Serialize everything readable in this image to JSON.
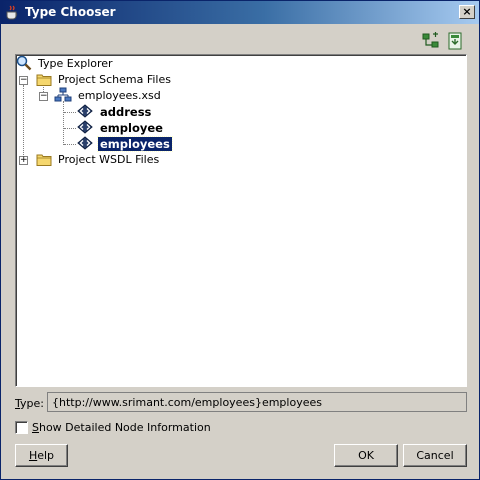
{
  "window": {
    "title": "Type Chooser",
    "close_glyph": "×"
  },
  "toolbar": {
    "icons": [
      "schema-hierarchy-icon",
      "import-schema-icon"
    ]
  },
  "tree": {
    "root": {
      "label": "Type Explorer",
      "icon": "magnifier-icon"
    },
    "nodes": [
      {
        "label": "Project Schema Files",
        "icon": "folder-icon",
        "expanded": true
      },
      {
        "label": "employees.xsd",
        "icon": "schema-file-icon",
        "expanded": true
      },
      {
        "label": "address",
        "icon": "element-icon",
        "bold": true
      },
      {
        "label": "employee",
        "icon": "element-icon",
        "bold": true
      },
      {
        "label": "employees",
        "icon": "element-icon",
        "bold": true,
        "selected": true
      },
      {
        "label": "Project WSDL Files",
        "icon": "folder-icon",
        "expanded": false
      }
    ]
  },
  "type_field": {
    "label_mnemonic": "T",
    "label_rest": "ype:",
    "value": "{http://www.srimant.com/employees}employees"
  },
  "checkbox": {
    "label_mnemonic": "S",
    "label_rest": "how Detailed Node Information",
    "checked": false
  },
  "buttons": {
    "help_mnemonic": "H",
    "help_rest": "elp",
    "ok": "OK",
    "cancel": "Cancel"
  },
  "colors": {
    "selection": "#0a246a",
    "dialog_bg": "#d4d0c8",
    "title_gradient_start": "#0a246a",
    "title_gradient_end": "#a6caf0"
  }
}
